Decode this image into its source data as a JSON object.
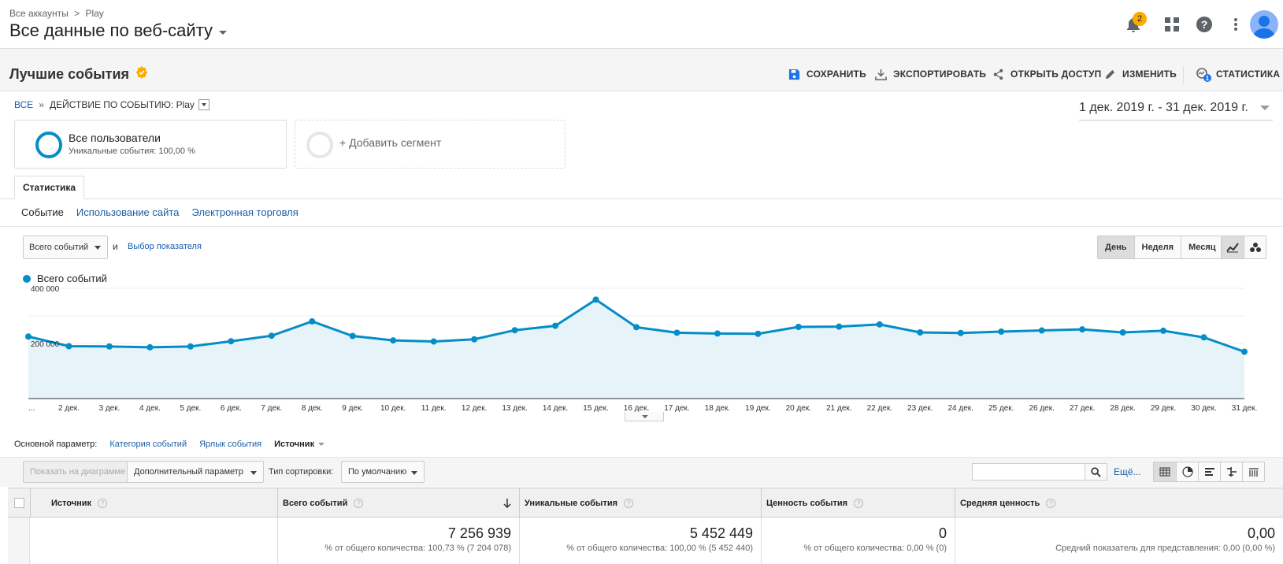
{
  "header": {
    "breadcrumb": [
      "Все аккаунты",
      ">",
      "Play"
    ],
    "view_title": "Все данные по веб-сайту",
    "notifications_count": "2"
  },
  "report": {
    "title": "Лучшие события",
    "actions": {
      "save": "СОХРАНИТЬ",
      "export": "ЭКСПОРТИРОВАТЬ",
      "share": "ОТКРЫТЬ ДОСТУП",
      "edit": "ИЗМЕНИТЬ",
      "stats": "СТАТИСТИКА"
    },
    "stats_badge": "1"
  },
  "path": {
    "all": "ВСЕ",
    "sep": "»",
    "current": "ДЕЙСТВИЕ ПО СОБЫТИЮ: Play"
  },
  "date_range": "1 дек. 2019 г. - 31 дек. 2019 г.",
  "segments": {
    "seg1_name": "Все пользователи",
    "seg1_sub": "Уникальные события: 100,00 %",
    "seg2_name": "+ Добавить сегмент"
  },
  "tabs": {
    "main": "Статистика",
    "sub": [
      "Событие",
      "Использование сайта",
      "Электронная торговля"
    ]
  },
  "metric": {
    "select": "Всего событий",
    "and": "и",
    "choose": "Выбор показателя"
  },
  "period": [
    "День",
    "Неделя",
    "Месяц"
  ],
  "colors": {
    "accent": "#058dc7",
    "link": "#1a5ea8",
    "badge": "#f9ab00"
  },
  "chart_data": {
    "type": "area",
    "series": [
      {
        "name": "Всего событий",
        "values": [
          225000,
          190000,
          189000,
          186000,
          189000,
          208000,
          228000,
          280000,
          227000,
          211000,
          207000,
          215000,
          248000,
          264000,
          359000,
          259000,
          239000,
          236000,
          235000,
          260000,
          261000,
          269000,
          240000,
          238000,
          243000,
          247000,
          251000,
          240000,
          246000,
          222000,
          170000
        ]
      }
    ],
    "x": [
      "...",
      "2 дек.",
      "3 дек.",
      "4 дек.",
      "5 дек.",
      "6 дек.",
      "7 дек.",
      "8 дек.",
      "9 дек.",
      "10 дек.",
      "11 дек.",
      "12 дек.",
      "13 дек.",
      "14 дек.",
      "15 дек.",
      "16 дек.",
      "17 дек.",
      "18 дек.",
      "19 дек.",
      "20 дек.",
      "21 дек.",
      "22 дек.",
      "23 дек.",
      "24 дек.",
      "25 дек.",
      "26 дек.",
      "27 дек.",
      "28 дек.",
      "29 дек.",
      "30 дек.",
      "31 дек."
    ],
    "y_ticks": [
      "400 000",
      "200 000"
    ],
    "y_tick_values": [
      400000,
      200000
    ],
    "ylim": [
      0,
      400000
    ],
    "grid": true,
    "legend": "top-left"
  },
  "primary_dimension": {
    "label": "Основной параметр:",
    "options": [
      "Категория событий",
      "Ярлык события"
    ],
    "current": "Источник"
  },
  "toolbar": {
    "plot": "Показать на диаграмме",
    "secondary": "Дополнительный параметр",
    "sort_label": "Тип сортировки:",
    "sort_value": "По умолчанию",
    "search_placeholder": "",
    "more": "Ещё..."
  },
  "table": {
    "columns": [
      "Источник",
      "Всего событий",
      "Уникальные события",
      "Ценность события",
      "Средняя ценность"
    ],
    "totals": [
      {
        "value": "7 256 939",
        "sub": "% от общего количества: 100,73 % (7 204 078)"
      },
      {
        "value": "5 452 449",
        "sub": "% от общего количества: 100,00 % (5 452 440)"
      },
      {
        "value": "0",
        "sub": "% от общего количества: 0,00 % (0)"
      },
      {
        "value": "0,00",
        "sub": "Средний показатель для представления: 0,00 (0,00 %)"
      }
    ]
  }
}
